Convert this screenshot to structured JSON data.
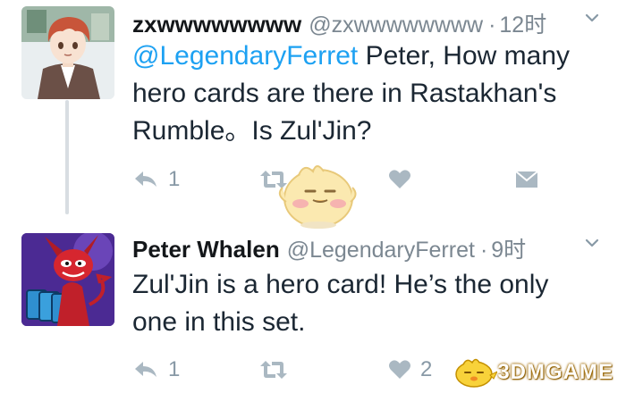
{
  "tweets": [
    {
      "display_name": "zxwwwwwwww",
      "handle": "@zxwwwwwwww",
      "dot": "·",
      "time": "12时",
      "mention": "@LegendaryFerret",
      "text_line1_rest": " Peter, How many",
      "text_line2": "hero cards are there  in Rastakhan's",
      "text_line3": "Rumble。Is Zul'Jin?",
      "reply_count": "1",
      "retweet_count": "",
      "like_count": ""
    },
    {
      "display_name": "Peter Whalen",
      "handle": "@LegendaryFerret",
      "dot": "·",
      "time": "9时",
      "text_line1": "Zul'Jin is a hero card!  He’s the only",
      "text_line2": "one in this set.",
      "reply_count": "1",
      "retweet_count": "",
      "like_count": "2"
    }
  ],
  "watermark": {
    "text": "3DMGAME"
  },
  "icons": {
    "reply": "reply-icon",
    "retweet": "retweet-icon",
    "like": "heart-icon",
    "dm": "envelope-icon",
    "more": "chevron-down-icon"
  },
  "colors": {
    "link": "#1da1f2",
    "muted": "#7b8791",
    "action_icon": "#aab8c2",
    "thread_line": "#d8dde2"
  }
}
